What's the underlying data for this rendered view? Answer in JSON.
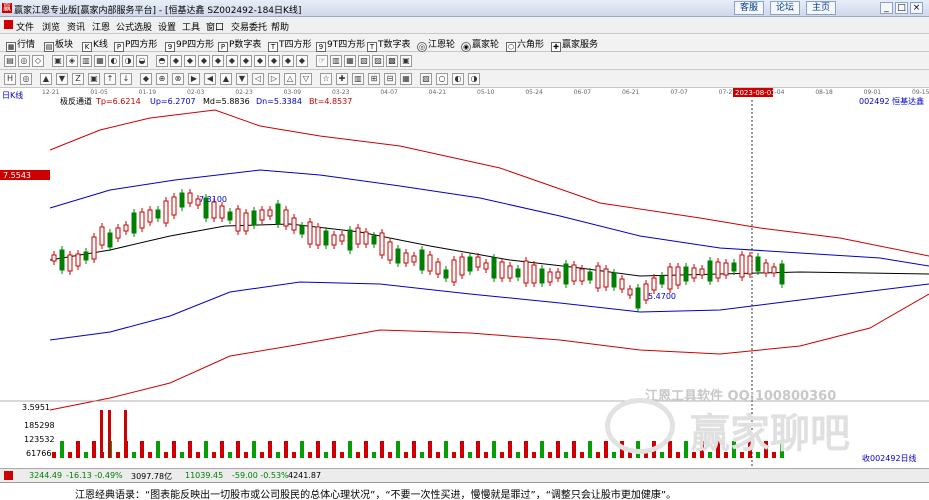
{
  "window": {
    "title": "赢家江恩专业版[赢家内部服务平台] - [恒基达鑫  SZ002492-184日K线]",
    "top_buttons": [
      "客服",
      "论坛",
      "主页"
    ],
    "controls": [
      "_",
      "□",
      "×"
    ]
  },
  "menu": [
    "文件",
    "浏览",
    "资讯",
    "江恩",
    "公式选股",
    "设置",
    "工具",
    "窗口",
    "交易委托",
    "帮助"
  ],
  "toolbar1": [
    {
      "icon": "grid-icon",
      "label": "行情"
    },
    {
      "icon": "sector-icon",
      "label": "板块"
    },
    {
      "icon": "kline-icon",
      "label": "K线"
    },
    {
      "icon": "p-square-icon",
      "label": "P四方形"
    },
    {
      "icon": "9p-square-icon",
      "label": "9P四方形"
    },
    {
      "icon": "p-number-icon",
      "label": "P数字表"
    },
    {
      "icon": "t-square-icon",
      "label": "T四方形"
    },
    {
      "icon": "9t-square-icon",
      "label": "9T四方形"
    },
    {
      "icon": "t-number-icon",
      "label": "T数字表"
    },
    {
      "icon": "gann-wheel-icon",
      "label": "江恩轮"
    },
    {
      "icon": "winner-wheel-icon",
      "label": "赢家轮"
    },
    {
      "icon": "hexagon-icon",
      "label": "六角形"
    },
    {
      "icon": "service-icon",
      "label": "赢家服务"
    }
  ],
  "chart": {
    "period": "日K线",
    "indicator_name": "极反通道",
    "indicators": [
      {
        "label": "Tp=6.6214",
        "color": "#cc0000"
      },
      {
        "label": "Up=6.2707",
        "color": "#0000cc"
      },
      {
        "label": "Md=5.8836",
        "color": "#000000"
      },
      {
        "label": "Dn=5.3384",
        "color": "#0000cc"
      },
      {
        "label": "Bt=4.8537",
        "color": "#cc0000"
      }
    ],
    "stock": "002492  恒基达鑫",
    "price_tag": "7.5543",
    "price_tag_color": "#cc0000",
    "high_label": "7.3100",
    "low_label": "5.4700",
    "cursor_date": "2023-08-01",
    "date_ticks": [
      "12-21",
      "01-05",
      "01-19",
      "02-03",
      "02-23",
      "03-09",
      "03-23",
      "04-07",
      "04-21",
      "05-10",
      "05-24",
      "06-07",
      "06-21",
      "07-07",
      "07-21",
      "08-04",
      "08-18",
      "09-01",
      "09-15"
    ],
    "volume_axis": [
      "3.5951",
      "185298",
      "123532",
      "61766"
    ],
    "volume_label": "收002492日线"
  },
  "status": {
    "index1": "3244.49",
    "index1_change": "-16.13 -0.49%",
    "index1_amount": "3097.78亿",
    "index2": "11039.45",
    "index2_change": "-59.00 -0.53%",
    "index2_amount": "4241.87"
  },
  "watermark": {
    "line1": "江恩工具软件  QQ:100800360",
    "line2": "赢家聊吧"
  },
  "quote": "江恩经典语录：“图表能反映出一切股市或公司股民的总体心理状况”，“不要一次性买进，慢慢就是罪过”，“调整只会让股市更加健康”。"
}
